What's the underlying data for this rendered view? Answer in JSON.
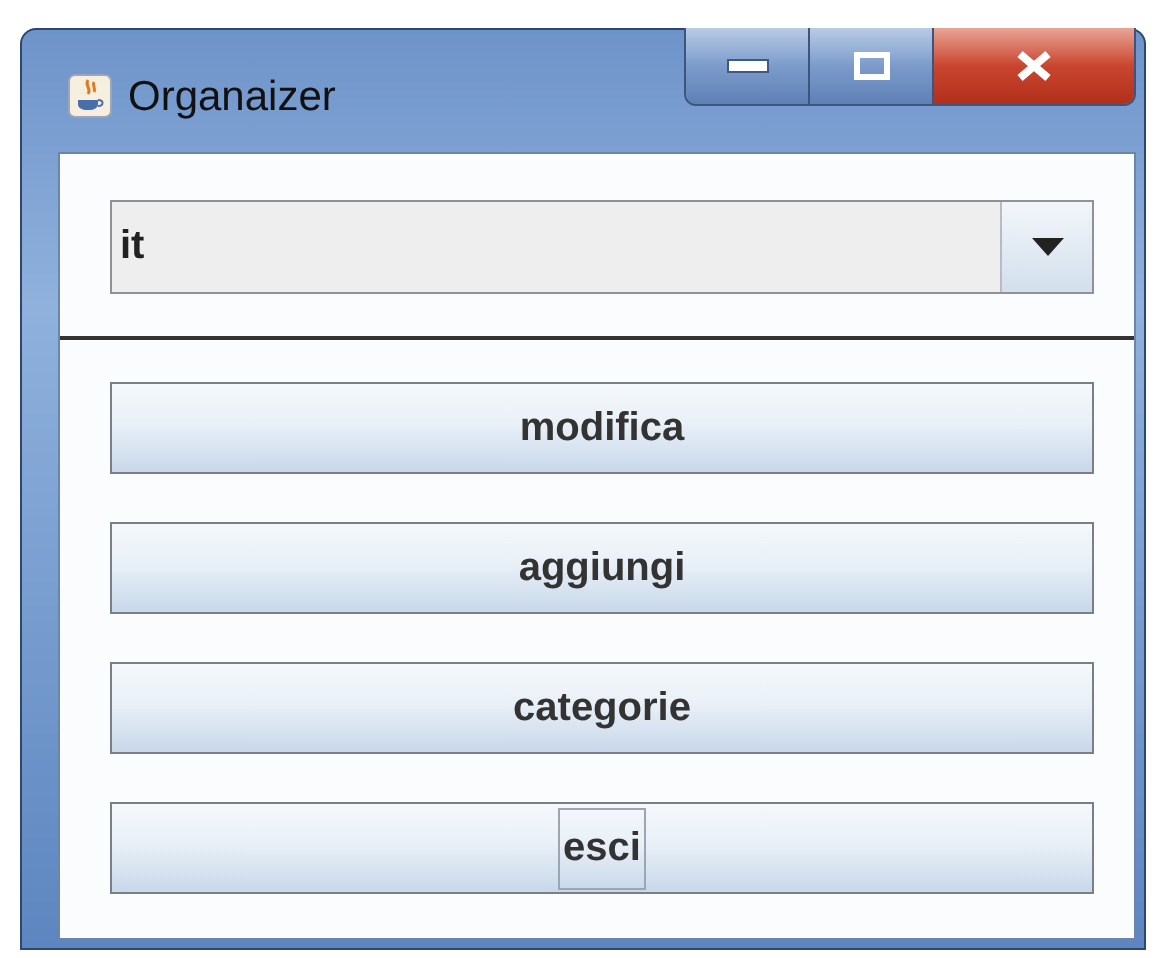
{
  "window": {
    "title": "Organaizer"
  },
  "combo": {
    "value": "it"
  },
  "buttons": [
    {
      "label": "modifica",
      "focused": false
    },
    {
      "label": "aggiungi",
      "focused": false
    },
    {
      "label": "categorie",
      "focused": false
    },
    {
      "label": "esci",
      "focused": true
    }
  ]
}
